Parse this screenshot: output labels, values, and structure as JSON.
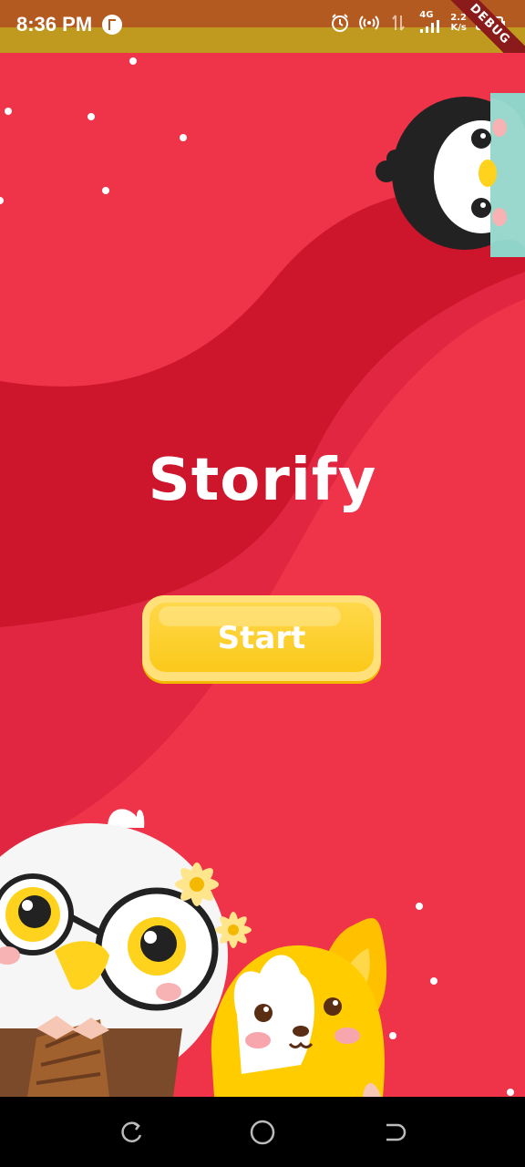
{
  "status_bar": {
    "time": "8:36 PM",
    "network": "4G",
    "speed_value": "2.2",
    "speed_unit": "K/s",
    "debug_banner": "DEBUG",
    "icons": [
      "alarm-icon",
      "hotspot-icon",
      "data-arrows-icon",
      "signal-icon",
      "battery-icon"
    ]
  },
  "app": {
    "title": "Storify",
    "start_label": "Start",
    "colors": {
      "background": "#ef3349",
      "wave_dark": "#cd152c",
      "button": "#fbc91a"
    }
  },
  "nav": {
    "buttons": [
      "recent-apps",
      "home",
      "back"
    ]
  }
}
